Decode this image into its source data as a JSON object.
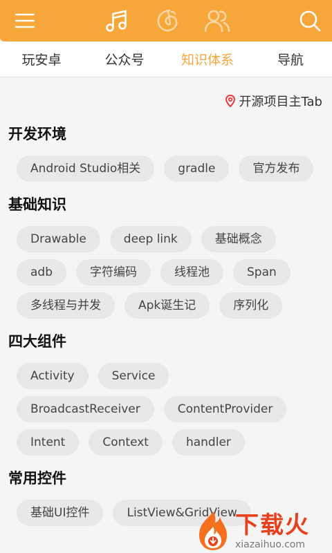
{
  "header": {
    "icons": [
      "menu-icon",
      "music-note-icon",
      "netease-music-icon",
      "friends-icon",
      "search-icon"
    ],
    "accent": "#f7a63a"
  },
  "tabs": [
    {
      "label": "玩安卓",
      "active": false
    },
    {
      "label": "公众号",
      "active": false
    },
    {
      "label": "知识体系",
      "active": true
    },
    {
      "label": "导航",
      "active": false
    }
  ],
  "content": {
    "open_source_link": "开源项目主Tab",
    "sections": [
      {
        "title": "开发环境",
        "tags": [
          "Android Studio相关",
          "gradle",
          "官方发布"
        ]
      },
      {
        "title": "基础知识",
        "tags": [
          "Drawable",
          "deep link",
          "基础概念",
          "adb",
          "字符编码",
          "线程池",
          "Span",
          "多线程与并发",
          "Apk诞生记",
          "序列化"
        ]
      },
      {
        "title": "四大组件",
        "tags": [
          "Activity",
          "Service",
          "BroadcastReceiver",
          "ContentProvider",
          "Intent",
          "Context",
          "handler"
        ]
      },
      {
        "title": "常用控件",
        "tags": [
          "基础UI控件",
          "ListView&GridView"
        ]
      }
    ]
  },
  "watermark": {
    "big": "下载火",
    "small": "xiazaihuo.com"
  }
}
